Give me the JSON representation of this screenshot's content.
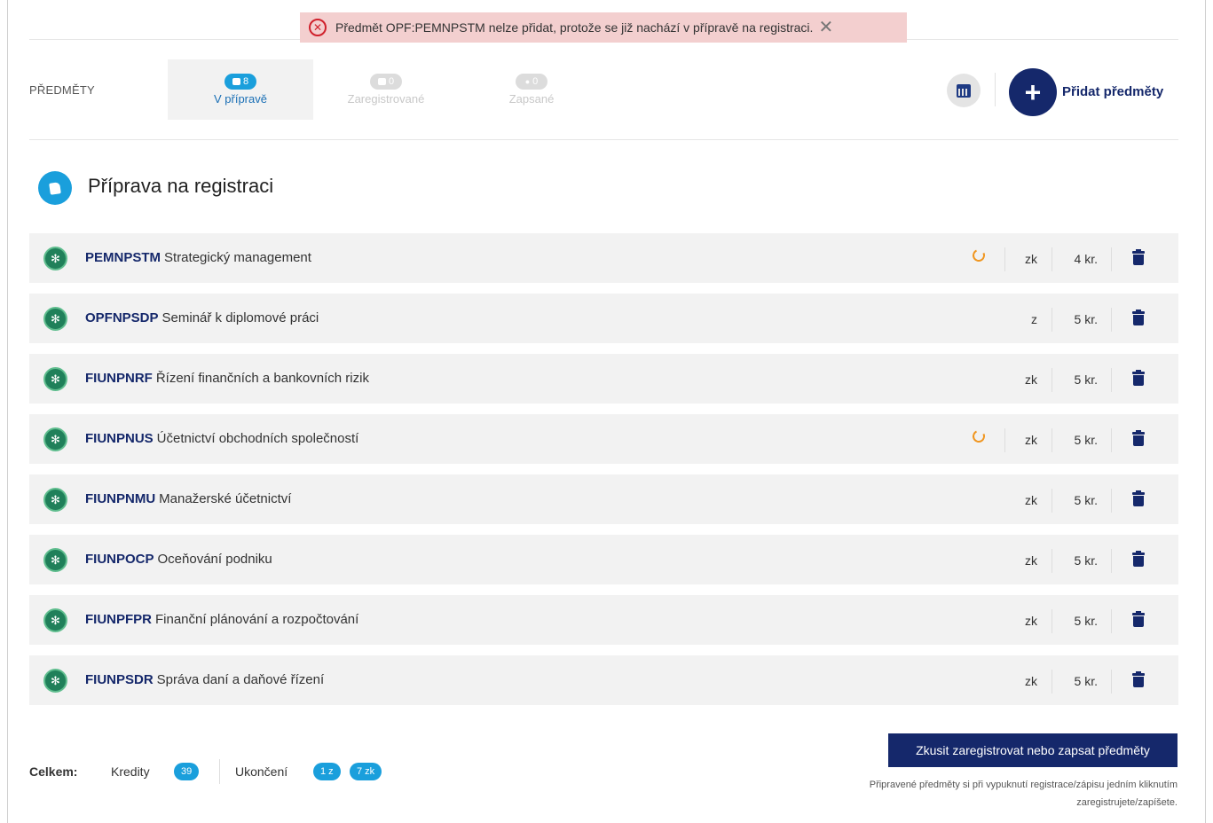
{
  "alert": {
    "message": "Předmět OPF:PEMNPSTM nelze přidat, protože se již nachází v přípravě na registraci.",
    "error_icon": "error-circle-icon",
    "close_glyph": "✕"
  },
  "header": {
    "section_label": "PŘEDMĚTY",
    "tabs": [
      {
        "label": "V přípravě",
        "count": "8",
        "active": true
      },
      {
        "label": "Zaregistrované",
        "count": "0",
        "active": false
      },
      {
        "label": "Zapsané",
        "count": "0",
        "active": false
      }
    ],
    "add_button_glyph": "+",
    "add_label": "Přidat předměty"
  },
  "section": {
    "title": "Příprava na registraci"
  },
  "courses": [
    {
      "code": "PEMNPSTM",
      "name": "Strategický management",
      "pending": true,
      "type": "zk",
      "credits": "4 kr."
    },
    {
      "code": "OPFNPSDP",
      "name": "Seminář k diplomové práci",
      "pending": false,
      "type": "z",
      "credits": "5 kr."
    },
    {
      "code": "FIUNPNRF",
      "name": "Řízení finančních a bankovních rizik",
      "pending": false,
      "type": "zk",
      "credits": "5 kr."
    },
    {
      "code": "FIUNPNUS",
      "name": "Účetnictví obchodních společností",
      "pending": true,
      "type": "zk",
      "credits": "5 kr."
    },
    {
      "code": "FIUNPNMU",
      "name": "Manažerské účetnictví",
      "pending": false,
      "type": "zk",
      "credits": "5 kr."
    },
    {
      "code": "FIUNPOCP",
      "name": "Oceňování podniku",
      "pending": false,
      "type": "zk",
      "credits": "5 kr."
    },
    {
      "code": "FIUNPFPR",
      "name": "Finanční plánování a rozpočtování",
      "pending": false,
      "type": "zk",
      "credits": "5 kr."
    },
    {
      "code": "FIUNPSDR",
      "name": "Správa daní a daňové řízení",
      "pending": false,
      "type": "zk",
      "credits": "5 kr."
    }
  ],
  "footer": {
    "total_label": "Celkem:",
    "credits_label": "Kredity",
    "credits_value": "39",
    "completion_label": "Ukončení",
    "completion_z": "1 z",
    "completion_zk": "7 zk",
    "submit_label": "Zkusit zaregistrovat nebo zapsat předměty",
    "hint_line1": "Připravené předměty si při vypuknutí registrace/zápisu jedním kliknutím",
    "hint_line2": "zaregistrujete/zapíšete."
  }
}
